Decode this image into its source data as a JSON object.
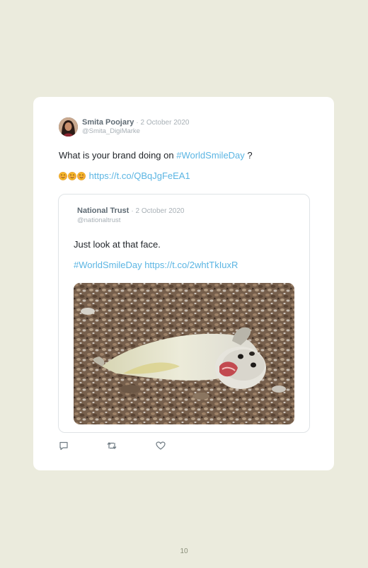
{
  "tweet": {
    "author_name": "Smita Poojary",
    "date": "· 2 October 2020",
    "handle": "@Smita_DigiMarke",
    "text_prefix": "What is your brand doing on ",
    "hashtag": "#WorldSmileDay",
    "text_suffix": " ?",
    "emojis": [
      "smiling-face-icon",
      "smiling-face-icon",
      "smiling-face-icon"
    ],
    "link": "https://t.co/QBqJgFeEA1"
  },
  "quoted": {
    "author_name": "National Trust",
    "date": "· 2 October 2020",
    "handle": "@nationaltrust",
    "text": "Just look at that face.",
    "hashtag": "#WorldSmileDay",
    "link": "https://t.co/2whtTkIuxR"
  },
  "actions": [
    "reply-icon",
    "retweet-icon",
    "like-icon"
  ],
  "colors": {
    "background": "#ebebdd",
    "link": "#5bb5e3",
    "meta": "#a8b0b6"
  },
  "page_number": "10"
}
